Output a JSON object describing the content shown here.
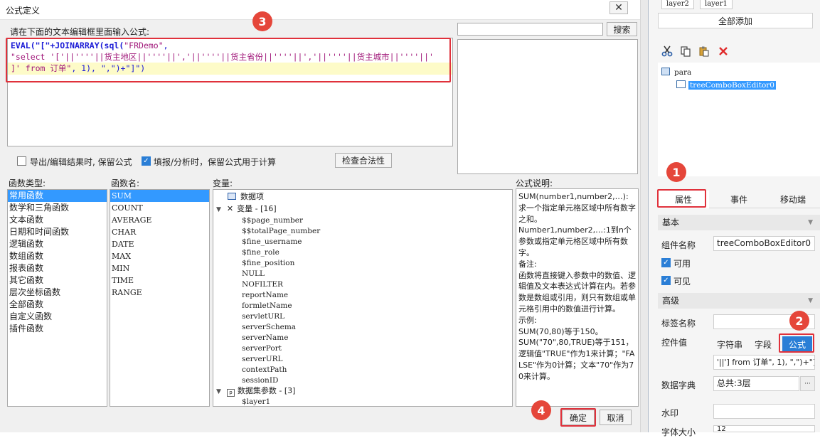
{
  "dialog": {
    "title": "公式定义",
    "close_glyph": "✕",
    "prompt_label": "请在下面的文本编辑框里面输入公式:",
    "formula_lines": [
      {
        "kw": "EVAL(\"[\"+JOINARRAY(sql(",
        "str": "\"FRDemo\"",
        "tail": ","
      },
      {
        "kw": "",
        "str": "\"select '['||''''||货主地区||''''||','||''''||货主省份||''''||','||''''||货主城市||''''||'",
        "tail": ""
      },
      {
        "kw": "",
        "str": "]' from 订单\"",
        "tail": ", 1), \",\")+\"]\")"
      }
    ],
    "search_button": "搜索",
    "option_export": "导出/编辑结果时, 保留公式",
    "option_fill": "填报/分析时，保留公式用于计算",
    "check_button": "检查合法性",
    "func_type_label": "函数类型:",
    "func_types": [
      "常用函数",
      "数学和三角函数",
      "文本函数",
      "日期和时间函数",
      "逻辑函数",
      "数组函数",
      "报表函数",
      "其它函数",
      "层次坐标函数",
      "全部函数",
      "自定义函数",
      "插件函数"
    ],
    "func_name_label": "函数名:",
    "func_names": [
      "SUM",
      "COUNT",
      "AVERAGE",
      "CHAR",
      "DATE",
      "MAX",
      "MIN",
      "TIME",
      "RANGE"
    ],
    "var_label": "变量:",
    "var_root": "数据项",
    "var_group": "变量 - [16]",
    "var_items": [
      "$$page_number",
      "$$totalPage_number",
      "$fine_username",
      "$fine_role",
      "$fine_position",
      "NULL",
      "NOFILTER",
      "reportName",
      "formletName",
      "servletURL",
      "serverSchema",
      "serverName",
      "serverPort",
      "serverURL",
      "contextPath",
      "sessionID"
    ],
    "ds_group": "数据集参数 - [3]",
    "ds_items": [
      "$layer1"
    ],
    "desc_label": "公式说明:",
    "desc_lines": [
      "SUM(number1,number2,…):求一个指定单元格区域中所有数字之和。",
      "Number1,number2,…:1到n个参数或指定单元格区域中所有数字。",
      "备注:",
      "函数将直接键入参数中的数值、逻辑值及文本表达式计算在内。若参数是数组或引用，则只有数组或单元格引用中的数值进行计算。",
      "示例:",
      "SUM(70,80)等于150。",
      "SUM(\"70\",80,TRUE)等于151，逻辑值\"TRUE\"作为1来计算；\"FALSE\"作为0计算；文本\"70\"作为70来计算。"
    ],
    "ok_button": "确定",
    "cancel_button": "取消"
  },
  "badges": [
    "1",
    "2",
    "3",
    "4"
  ],
  "panel": {
    "layer_tabs": [
      "layer2",
      "layer1"
    ],
    "add_all": "全部添加",
    "tree_root": "para",
    "tree_child": "treeComboBoxEditor0",
    "tabs": [
      "属性",
      "事件",
      "移动端"
    ],
    "sec_basic": "基本",
    "comp_name_label": "组件名称",
    "comp_name_value": "treeComboBoxEditor0",
    "enabled_label": "可用",
    "visible_label": "可见",
    "sec_adv": "高级",
    "tag_name_label": "标签名称",
    "ctrl_value_label": "控件值",
    "seg_string": "字符串",
    "seg_field": "字段",
    "seg_formula": "公式",
    "formula_preview": "'||'] from 订单\", 1), \",\")+\"]\")",
    "dict_label": "数据字典",
    "dict_value": "总共:3层",
    "dict_btn": "···",
    "watermark_label": "水印",
    "font_size_label": "字体大小",
    "font_size_value": "12"
  },
  "colors": {
    "annotation_red": "#e0313b",
    "selection_blue": "#3399ff"
  }
}
